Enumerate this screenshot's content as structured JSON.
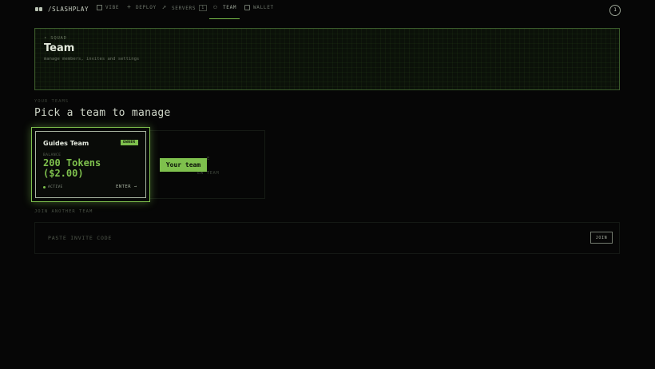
{
  "nav": {
    "brand": "/SLASHPLAY",
    "items": [
      {
        "label": "VIBE",
        "icon": "box-icon"
      },
      {
        "label": "DEPLOY",
        "icon": "plus-icon"
      },
      {
        "label": "SERVERS",
        "icon": "rocket-icon",
        "count": "1"
      },
      {
        "label": "TEAM",
        "icon": "people-icon",
        "active": true
      },
      {
        "label": "WALLET",
        "icon": "wallet-icon"
      }
    ],
    "avatar_initial": "1"
  },
  "header": {
    "eyebrow": "• SQUAD",
    "title": "Team",
    "subtitle": "manage members, invites and settings"
  },
  "teams_section": {
    "label": "YOUR TEAMS",
    "title": "Pick a team to manage"
  },
  "team_card": {
    "name": "Guides Team",
    "role_badge": "OWNER",
    "balance_label": "BALANCE",
    "balance_line1": "200 Tokens",
    "balance_line2": "($2.00)",
    "status": "ACTIVE",
    "enter_label": "ENTER →"
  },
  "ghost_card": {
    "fragment1": "E",
    "fragment2": "EW TEAM"
  },
  "tooltip": "Your team",
  "join": {
    "label": "JOIN ANOTHER TEAM",
    "placeholder": "PASTE INVITE CODE",
    "button_label": "JOIN"
  },
  "colors": {
    "accent": "#7ec04d",
    "background": "#060606"
  }
}
